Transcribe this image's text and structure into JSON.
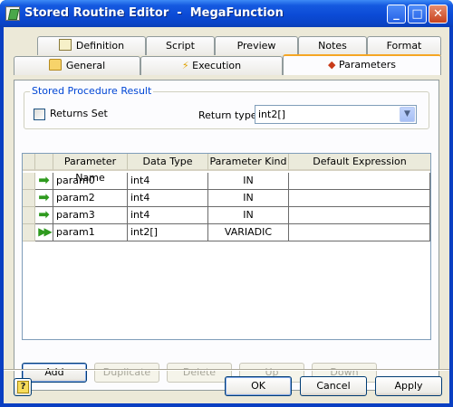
{
  "window": {
    "title": "Stored Routine Editor  -  MegaFunction",
    "minimize": "_",
    "maximize": "□",
    "close": "✕",
    "colors": {
      "titlebar": "#0b4bd6",
      "client": "#ece9d8",
      "tab_highlight": "#f5a623",
      "group_title": "#0046d5"
    }
  },
  "tabs": {
    "row1": [
      "Definition",
      "Script",
      "Preview",
      "Notes",
      "Format"
    ],
    "row2": [
      "General",
      "Execution",
      "Parameters"
    ],
    "active": "Parameters"
  },
  "result_group": {
    "title": "Stored Procedure Result",
    "returns_set_label": "Returns Set",
    "returns_set_checked": false,
    "return_type_label": "Return type",
    "return_type_value": "int2[]"
  },
  "grid": {
    "columns": [
      "Parameter Name",
      "Data Type",
      "Parameter Kind",
      "Default Expression"
    ],
    "rows": [
      {
        "icon": "in-arrow-icon",
        "name": "param0",
        "type": "int4",
        "kind": "IN",
        "default": ""
      },
      {
        "icon": "in-arrow-icon",
        "name": "param2",
        "type": "int4",
        "kind": "IN",
        "default": ""
      },
      {
        "icon": "in-arrow-icon",
        "name": "param3",
        "type": "int4",
        "kind": "IN",
        "default": ""
      },
      {
        "icon": "variadic-arrow-icon",
        "name": "param1",
        "type": "int2[]",
        "kind": "VARIADIC",
        "default": ""
      }
    ]
  },
  "param_buttons": {
    "add": "Add",
    "duplicate": "Duplicate",
    "delete": "Delete",
    "up": "Up",
    "down": "Down"
  },
  "footer": {
    "help_icon": "?",
    "ok": "OK",
    "cancel": "Cancel",
    "apply": "Apply"
  }
}
